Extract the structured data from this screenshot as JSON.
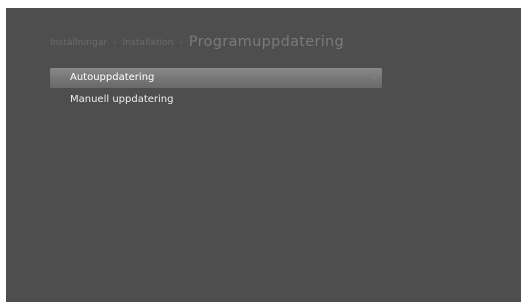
{
  "header": {
    "crumb_1": "Inställningar",
    "crumb_2": "Installation",
    "separator": "›",
    "current": "Programuppdatering"
  },
  "menu": {
    "items": [
      {
        "label": "Autouppdatering",
        "selected": true,
        "arrow": "›"
      },
      {
        "label": "Manuell uppdatering",
        "selected": false
      }
    ]
  },
  "colors": {
    "background": "#4e4e4e",
    "selection": "#7a7a7a",
    "text": "#eeeeee",
    "breadcrumb": "#6c6c6c"
  }
}
